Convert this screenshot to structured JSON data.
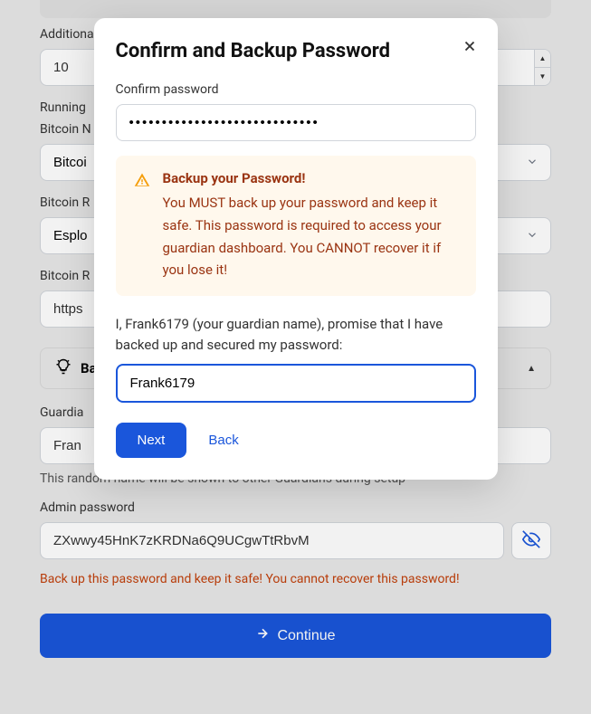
{
  "background": {
    "additional_label": "Additiona",
    "additional_value": "10",
    "running_label": "Running",
    "bitcoin_n_label": "Bitcoin N",
    "bitcoin_n_value": "Bitcoi",
    "bitcoin_r1_label": "Bitcoin R",
    "bitcoin_r1_value": "Esplo",
    "bitcoin_r2_label": "Bitcoin R",
    "bitcoin_r2_value": "https",
    "basic_label": "Bas",
    "guardian_label": "Guardia",
    "guardian_value": "Fran",
    "guardian_helper": "This random name will be shown to other Guardians during setup",
    "admin_password_label": "Admin password",
    "admin_password_value": "ZXwwy45HnK7zKRDNa6Q9UCgwTtRbvM",
    "password_warning": "Back up this password and keep it safe! You cannot recover this password!",
    "continue_label": "Continue"
  },
  "modal": {
    "title": "Confirm and Backup Password",
    "confirm_password_label": "Confirm password",
    "confirm_password_value": "•••••••••••••••••••••••••••••",
    "alert_title": "Backup your Password!",
    "alert_text": "You MUST back up your password and keep it safe. This password is required to access your guardian dashboard. You CANNOT recover it if you lose it!",
    "promise_text": "I, Frank6179 (your guardian name), promise that I have backed up and secured my password:",
    "promise_input_value": "Frank6179",
    "next_label": "Next",
    "back_label": "Back"
  }
}
